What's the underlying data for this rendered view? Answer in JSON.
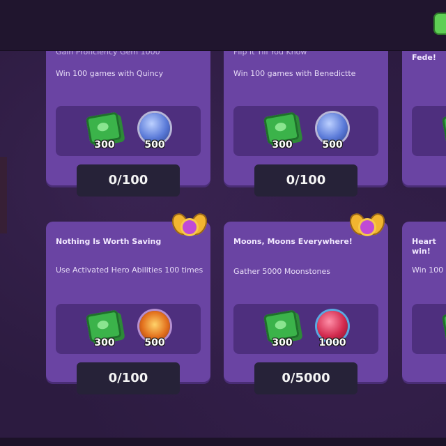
{
  "cards": [
    {
      "title": "Gain Proficiency Gem 1000",
      "description": "Win 100 games with Quincy",
      "rewards": [
        {
          "type": "cash-icon",
          "amount": "300"
        },
        {
          "type": "knowledge-orb-icon",
          "amount": "500"
        }
      ],
      "progress": "0/100"
    },
    {
      "title": "Flip It Till You Know",
      "description": "Win 100 games with Benedictte",
      "rewards": [
        {
          "type": "cash-icon",
          "amount": "300"
        },
        {
          "type": "knowledge-orb-icon",
          "amount": "500"
        }
      ],
      "progress": "0/100"
    },
    {
      "title": "Fede!",
      "description": "",
      "rewards": [
        {
          "type": "cash-icon",
          "amount": ""
        }
      ],
      "progress": ""
    },
    {
      "title": "Nothing Is Worth Saving",
      "description": "Use Activated Hero Abilities 100 times",
      "rewards": [
        {
          "type": "cash-icon",
          "amount": "300"
        },
        {
          "type": "power-orb-icon",
          "amount": "500"
        }
      ],
      "progress": "0/100"
    },
    {
      "title": "Moons, Moons Everywhere!",
      "description": "Gather 5000 Moonstones",
      "rewards": [
        {
          "type": "cash-icon",
          "amount": "300"
        },
        {
          "type": "moonstone-orb-icon",
          "amount": "1000"
        }
      ],
      "progress": "0/5000"
    },
    {
      "title": "Heart win!",
      "description": "Win 100",
      "rewards": [
        {
          "type": "cash-icon",
          "amount": ""
        }
      ],
      "progress": ""
    }
  ]
}
